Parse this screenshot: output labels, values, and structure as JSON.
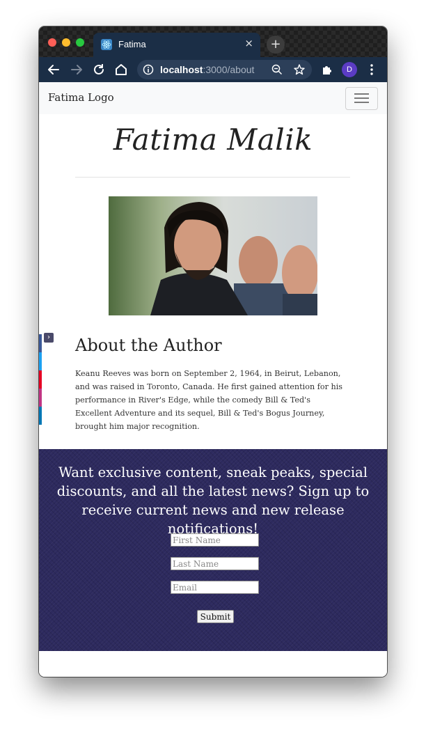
{
  "browser": {
    "tab_title": "Fatima",
    "tab_close": "×",
    "new_tab": "+",
    "url_host": "localhost",
    "url_path": ":3000/about",
    "profile_initial": "D"
  },
  "navbar": {
    "brand": "Fatima Logo"
  },
  "hero": {
    "author_name": "Fatima Malik"
  },
  "about": {
    "title": "About the Author",
    "bio": "Keanu Reeves was born on September 2, 1964, in Beirut, Lebanon, and was raised in Toronto, Canada. He first gained attention for his performance in River's Edge, while the comedy Bill & Ted's Excellent Adventure and its sequel, Bill & Ted's Bogus Journey, brought him major recognition."
  },
  "share": {
    "toggle": "›",
    "colors": [
      "#3b5998",
      "#1da1f2",
      "#e60023",
      "#c13584",
      "#0077b5"
    ]
  },
  "signup": {
    "message": "Want exclusive content, sneak peaks, special discounts, and all the latest news? Sign up to receive current news and new release notifications!",
    "first_name_placeholder": "First Name",
    "last_name_placeholder": "Last Name",
    "email_placeholder": "Email",
    "submit_label": "Submit",
    "background_color": "#2d2a5e"
  }
}
